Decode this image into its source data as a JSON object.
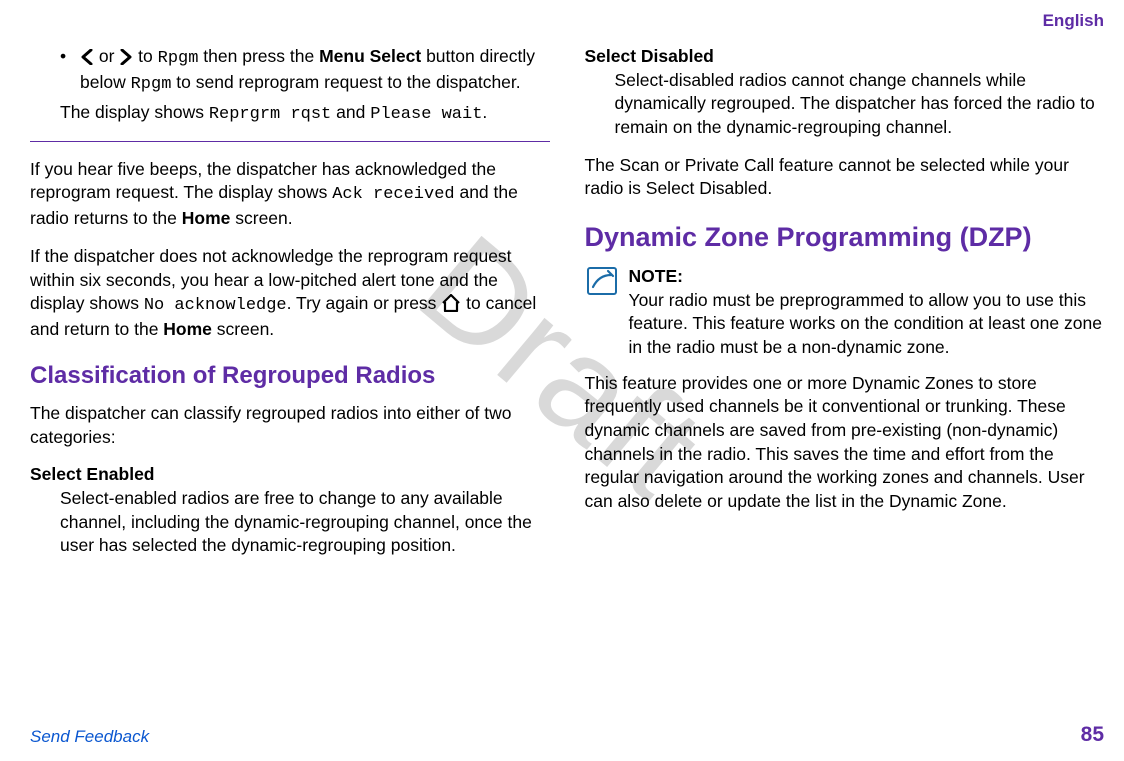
{
  "header": {
    "lang": "English"
  },
  "watermark": "Draft",
  "col1": {
    "bullet_parts": {
      "a": " or ",
      "b": " to ",
      "rpgm": "Rpgm",
      "c": " then press the ",
      "menu_select": "Menu Select",
      "d": " button directly below ",
      "e": " to send reprogram request to the dispatcher."
    },
    "display_line": {
      "a": "The display shows ",
      "code1": "Reprgrm rqst",
      "b": " and ",
      "code2": "Please wait",
      "c": "."
    },
    "p1": {
      "a": "If you hear five beeps, the dispatcher has acknowledged the reprogram request. The display shows ",
      "code": "Ack received",
      "b": " and the radio returns to the ",
      "home": "Home",
      "c": " screen."
    },
    "p2": {
      "a": "If the dispatcher does not acknowledge the reprogram request within six seconds, you hear a low-pitched alert tone and the display shows ",
      "code": "No acknowledge",
      "b": ". Try again or press ",
      "c": " to cancel and return to the ",
      "home": "Home",
      "d": " screen."
    },
    "h1": "Classification of Regrouped Radios",
    "p3": "The dispatcher can classify regrouped radios into either of two categories:",
    "dt1": "Select Enabled",
    "dd1": "Select-enabled radios are free to change to any available channel, including the dynamic-regrouping channel, once the user has selected the dynamic-regrouping position."
  },
  "col2": {
    "dt2": "Select Disabled",
    "dd2": "Select-disabled radios cannot change channels while dynamically regrouped. The dispatcher has forced the radio to remain on the dynamic-regrouping channel.",
    "p4": "The Scan or Private Call feature cannot be selected while your radio is Select Disabled.",
    "h2": "Dynamic Zone Programming (DZP)",
    "note_head": "NOTE:",
    "note_body": "Your radio must be preprogrammed to allow you to use this feature. This feature works on the condition at least one zone in the radio must be a non-dynamic zone.",
    "p5": "This feature provides one or more Dynamic Zones to store frequently used channels be it conventional or trunking. These dynamic channels are saved from pre-existing (non-dynamic) channels in the radio. This saves the time and effort from the regular navigation around the working zones and channels. User can also delete or update the list in the Dynamic Zone."
  },
  "footer": {
    "feedback": "Send Feedback",
    "page": "85"
  }
}
